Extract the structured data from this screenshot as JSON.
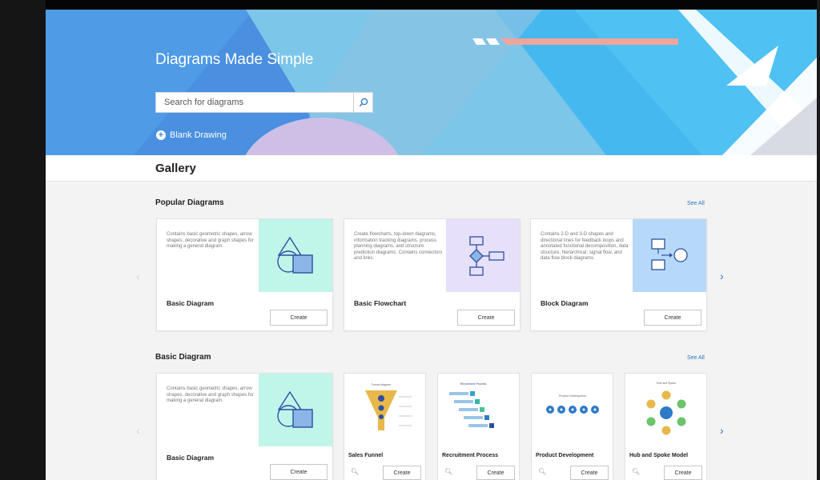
{
  "hero": {
    "title": "Diagrams Made Simple",
    "search_placeholder": "Search for diagrams",
    "blank_drawing": "Blank Drawing"
  },
  "gallery": {
    "title": "Gallery"
  },
  "popular": {
    "title": "Popular Diagrams",
    "see_all": "See All",
    "cards": [
      {
        "name": "Basic Diagram",
        "desc": "Contains basic geometric shapes, arrow shapes, decorative and graph shapes for making a general diagram.",
        "create": "Create",
        "thumb_color": "#c0f5ea"
      },
      {
        "name": "Basic Flowchart",
        "desc": "Create flowcharts, top-down diagrams, information tracking diagrams, process planning diagrams, and structure prediction diagrams. Contains connectors and links.",
        "create": "Create",
        "thumb_color": "#e6e0fb"
      },
      {
        "name": "Block Diagram",
        "desc": "Contains 2-D and 3-D shapes and directional lines for feedback loops and annotated functional decomposition, data structure, hierarchical, signal flow, and data flow block diagrams.",
        "create": "Create",
        "thumb_color": "#b6d9f9"
      }
    ]
  },
  "basic": {
    "title": "Basic Diagram",
    "see_all": "See All",
    "featured": {
      "name": "Basic Diagram",
      "desc": "Contains basic geometric shapes, arrow shapes, decorative and graph shapes for making a general diagram.",
      "create": "Create"
    },
    "templates": [
      {
        "name": "Sales Funnel",
        "create": "Create",
        "thumb_title": "Funnel diagram"
      },
      {
        "name": "Recruitment Process",
        "create": "Create",
        "thumb_title": "Recruitment Process"
      },
      {
        "name": "Product Development",
        "create": "Create",
        "thumb_title": "Product Development"
      },
      {
        "name": "Hub and Spoke Model",
        "create": "Create",
        "thumb_title": "Hub and Spoke"
      }
    ]
  },
  "icons": {
    "search": "search-icon",
    "next": "chevron-right-icon",
    "prev": "chevron-left-icon",
    "zoom": "zoom-icon"
  }
}
